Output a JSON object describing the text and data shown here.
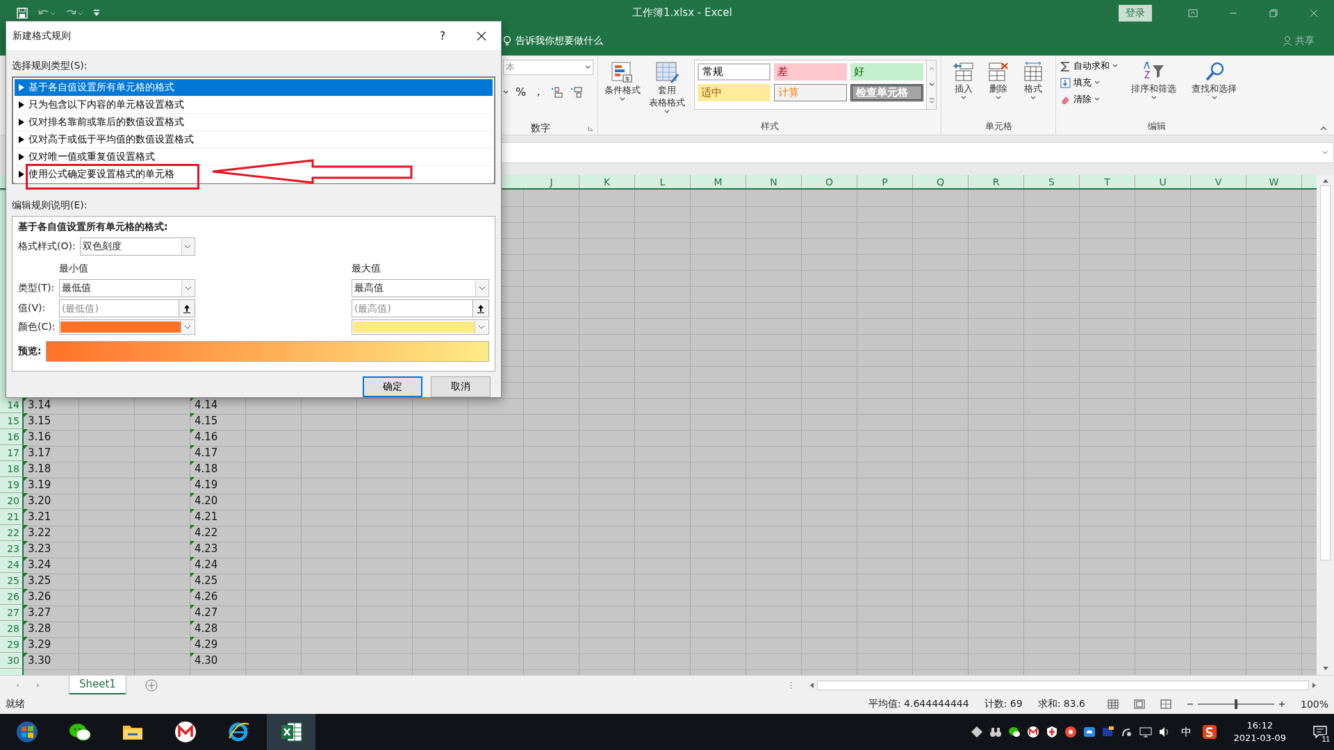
{
  "title_bar": {
    "title": "工作簿1.xlsx  -  Excel",
    "sign_in": "登录"
  },
  "tell_me": "告诉我你想要做什么",
  "share": "共享",
  "ribbon": {
    "number_group": {
      "format_box": "本",
      "percent": "%",
      "comma": "，",
      "label": "数字"
    },
    "styles_group": {
      "buttons": [
        {
          "lines": [
            "条件格式"
          ]
        },
        {
          "lines": [
            "套用",
            "表格格式"
          ]
        }
      ],
      "gallery": [
        {
          "text": "常规",
          "kind": "normal"
        },
        {
          "text": "差",
          "kind": "bad"
        },
        {
          "text": "好",
          "kind": "good"
        },
        {
          "text": "适中",
          "kind": "neutral"
        },
        {
          "text": "计算",
          "kind": "calculation"
        },
        {
          "text": "检查单元格",
          "kind": "check"
        }
      ],
      "label": "样式"
    },
    "cells_group": {
      "buttons": [
        {
          "label": "插入",
          "kind": "insert"
        },
        {
          "label": "删除",
          "kind": "delete"
        },
        {
          "label": "格式",
          "kind": "format"
        }
      ],
      "label": "单元格"
    },
    "editing_group": {
      "small_buttons": [
        {
          "label": "自动求和",
          "kind": "sum"
        },
        {
          "label": "填充",
          "kind": "fill"
        },
        {
          "label": "清除",
          "kind": "clear"
        }
      ],
      "buttons": [
        {
          "label": "排序和筛选",
          "kind": "sort"
        },
        {
          "label": "查找和选择",
          "kind": "find"
        }
      ],
      "label": "编辑"
    }
  },
  "sheet": {
    "columns": [
      "J",
      "K",
      "L",
      "M",
      "N",
      "O",
      "P",
      "Q",
      "R",
      "S",
      "T",
      "U",
      "V",
      "W"
    ],
    "rows": [
      {
        "number": "14",
        "col_a": "3.14",
        "col_d": "4.14"
      },
      {
        "number": "15",
        "col_a": "3.15",
        "col_d": "4.15"
      },
      {
        "number": "16",
        "col_a": "3.16",
        "col_d": "4.16"
      },
      {
        "number": "17",
        "col_a": "3.17",
        "col_d": "4.17"
      },
      {
        "number": "18",
        "col_a": "3.18",
        "col_d": "4.18"
      },
      {
        "number": "19",
        "col_a": "3.19",
        "col_d": "4.19"
      },
      {
        "number": "20",
        "col_a": "3.20",
        "col_d": "4.20"
      },
      {
        "number": "21",
        "col_a": "3.21",
        "col_d": "4.21"
      },
      {
        "number": "22",
        "col_a": "3.22",
        "col_d": "4.22"
      },
      {
        "number": "23",
        "col_a": "3.23",
        "col_d": "4.23"
      },
      {
        "number": "24",
        "col_a": "3.24",
        "col_d": "4.24"
      },
      {
        "number": "25",
        "col_a": "3.25",
        "col_d": "4.25"
      },
      {
        "number": "26",
        "col_a": "3.26",
        "col_d": "4.26"
      },
      {
        "number": "27",
        "col_a": "3.27",
        "col_d": "4.27"
      },
      {
        "number": "28",
        "col_a": "3.28",
        "col_d": "4.28"
      },
      {
        "number": "29",
        "col_a": "3.29",
        "col_d": "4.29"
      },
      {
        "number": "30",
        "col_a": "3.30",
        "col_d": "4.30"
      }
    ]
  },
  "sheet_tabs": [
    {
      "label": "Sheet1",
      "selected": true
    }
  ],
  "status_bar": {
    "state": "就绪",
    "average": "平均值: 4.644444444",
    "count": "计数: 69",
    "sum": "求和: 83.6",
    "zoom_slider": {
      "level": 0.5
    },
    "zoom": "100%"
  },
  "taskbar": {
    "ime": "中",
    "time": "16:12",
    "date": "2021-03-09",
    "notifications": "11"
  },
  "dialog": {
    "title": "新建格式规则",
    "help": "?",
    "rule_type_label": "选择规则类型(S):",
    "rule_types": [
      {
        "text": "基于各自值设置所有单元格的格式",
        "selected": true,
        "annotated": false
      },
      {
        "text": "只为包含以下内容的单元格设置格式",
        "selected": false,
        "annotated": false
      },
      {
        "text": "仅对排名靠前或靠后的数值设置格式",
        "selected": false,
        "annotated": false
      },
      {
        "text": "仅对高于或低于平均值的数值设置格式",
        "selected": false,
        "annotated": false
      },
      {
        "text": "仅对唯一值或重复值设置格式",
        "selected": false,
        "annotated": false
      },
      {
        "text": "使用公式确定要设置格式的单元格",
        "selected": false,
        "annotated": true
      }
    ],
    "edit_label": "编辑规则说明(E):",
    "heading": "基于各自值设置所有单元格的格式:",
    "format_style_label": "格式样式(O):",
    "format_style": "双色刻度",
    "min_header": "最小值",
    "max_header": "最大值",
    "type_label": "类型(T):",
    "value_label": "值(V):",
    "color_label": "颜色(C):",
    "min": {
      "type": "最低值",
      "placeholder": "(最低值)",
      "color": "#ff7128"
    },
    "max": {
      "type": "最高值",
      "placeholder": "(最高值)",
      "color": "#ffeb84"
    },
    "preview_label": "预览:",
    "ok": "确定",
    "cancel": "取消"
  }
}
